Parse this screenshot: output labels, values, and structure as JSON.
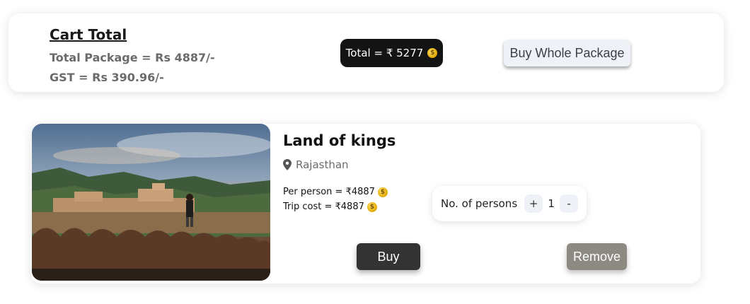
{
  "cart": {
    "title": "Cart Total",
    "total_package": "Total Package = Rs 4887/-",
    "gst": "GST = Rs 390.96/-",
    "total_label": "Total = ₹ 5277",
    "buy_whole_label": "Buy Whole Package"
  },
  "trip": {
    "name": "Land of kings",
    "location": "Rajasthan",
    "per_person": "Per person = ₹4887",
    "trip_cost": "Trip cost = ₹4887",
    "persons_label": "No. of persons",
    "plus_label": "+",
    "count": "1",
    "minus_label": "-",
    "buy_label": "Buy",
    "remove_label": "Remove"
  },
  "icons": {
    "coin": "money-bag-icon",
    "location": "location-pin-icon",
    "image": "rajasthan-fort-photo"
  },
  "colors": {
    "total_pill_bg": "#141414",
    "buy_button_bg": "#333333",
    "remove_button_bg": "#8c8a82",
    "buy_package_bg": "#eef1f6"
  }
}
